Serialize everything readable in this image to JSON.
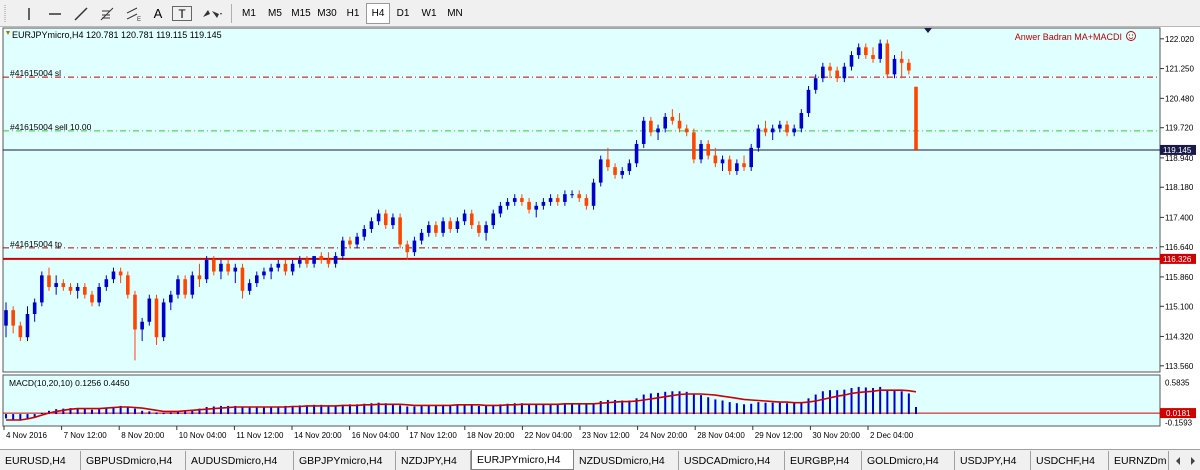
{
  "toolbar": {
    "tools": [
      "vertical-line-icon",
      "horizontal-line-icon",
      "trendline-icon",
      "fibonacci-icon",
      "text-icon",
      "text-label-icon",
      "arrows-icon"
    ],
    "text_tool": "A",
    "label_tool": "T",
    "timeframes": [
      "M1",
      "M5",
      "M15",
      "M30",
      "H1",
      "H4",
      "D1",
      "W1",
      "MN"
    ],
    "active_timeframe": "H4"
  },
  "chart": {
    "header": "EURJPYmicro,H4  120.781 120.781 119.115 119.145",
    "indicator_name": "Anwer Badran MA+MACDI",
    "order_sl_label": "#41615004 sl",
    "order_sell_label": "#41615004 sell 10.00",
    "order_tp_label": "#41615004 tp",
    "bid_price_tag": "119.145",
    "support_price_tag": "116.326",
    "y_axis_ticks": [
      "122.020",
      "121.250",
      "120.480",
      "119.720",
      "118.940",
      "118.180",
      "117.400",
      "116.640",
      "115.860",
      "115.100",
      "114.320",
      "113.560"
    ],
    "y_range": [
      113.4,
      122.3
    ],
    "x_axis_ticks": [
      "4 Nov 2016",
      "7 Nov 12:00",
      "8 Nov 20:00",
      "10 Nov 04:00",
      "11 Nov 12:00",
      "14 Nov 20:00",
      "16 Nov 04:00",
      "17 Nov 12:00",
      "18 Nov 20:00",
      "22 Nov 04:00",
      "23 Nov 12:00",
      "24 Nov 20:00",
      "28 Nov 04:00",
      "29 Nov 12:00",
      "30 Nov 20:00",
      "2 Dec 04:00"
    ],
    "levels": {
      "sl": 121.03,
      "sell": 119.64,
      "bid": 119.145,
      "tp": 116.61,
      "support": 116.326
    },
    "colors": {
      "background": "#e0ffff",
      "bull": "#0000cd",
      "bear": "#ff4500",
      "sl": "#c00000",
      "sell": "#32cd32",
      "support": "#d00000",
      "macd_line": "#d00000"
    }
  },
  "macd": {
    "label": "MACD(10,20,10) 0.1256 0.4450",
    "y_axis_ticks": [
      "0.5835",
      "0.0181",
      "-0.1593"
    ],
    "value_tag": "0.0181",
    "y_range": [
      -0.22,
      0.72
    ]
  },
  "chart_data": {
    "type": "candlestick",
    "title": "EURJPYmicro,H4",
    "candles": [
      {
        "o": 114.6,
        "h": 115.2,
        "l": 114.3,
        "c": 115.0
      },
      {
        "o": 115.0,
        "h": 115.1,
        "l": 114.4,
        "c": 114.6
      },
      {
        "o": 114.6,
        "h": 114.7,
        "l": 114.2,
        "c": 114.3
      },
      {
        "o": 114.3,
        "h": 115.1,
        "l": 114.2,
        "c": 114.9
      },
      {
        "o": 114.9,
        "h": 115.3,
        "l": 114.7,
        "c": 115.2
      },
      {
        "o": 115.2,
        "h": 116.0,
        "l": 115.1,
        "c": 115.9
      },
      {
        "o": 115.9,
        "h": 116.1,
        "l": 115.5,
        "c": 115.6
      },
      {
        "o": 115.6,
        "h": 115.9,
        "l": 115.4,
        "c": 115.7
      },
      {
        "o": 115.7,
        "h": 115.8,
        "l": 115.5,
        "c": 115.6
      },
      {
        "o": 115.6,
        "h": 115.7,
        "l": 115.4,
        "c": 115.5
      },
      {
        "o": 115.5,
        "h": 115.7,
        "l": 115.3,
        "c": 115.6
      },
      {
        "o": 115.6,
        "h": 115.7,
        "l": 115.3,
        "c": 115.4
      },
      {
        "o": 115.4,
        "h": 115.5,
        "l": 115.1,
        "c": 115.2
      },
      {
        "o": 115.2,
        "h": 115.7,
        "l": 115.1,
        "c": 115.6
      },
      {
        "o": 115.6,
        "h": 115.9,
        "l": 115.5,
        "c": 115.8
      },
      {
        "o": 115.8,
        "h": 116.1,
        "l": 115.7,
        "c": 116.0
      },
      {
        "o": 116.0,
        "h": 116.1,
        "l": 115.7,
        "c": 115.9
      },
      {
        "o": 115.9,
        "h": 116.0,
        "l": 115.3,
        "c": 115.4
      },
      {
        "o": 115.4,
        "h": 115.5,
        "l": 113.7,
        "c": 114.5
      },
      {
        "o": 114.5,
        "h": 114.8,
        "l": 114.2,
        "c": 114.7
      },
      {
        "o": 114.7,
        "h": 115.4,
        "l": 114.6,
        "c": 115.3
      },
      {
        "o": 115.3,
        "h": 115.4,
        "l": 114.1,
        "c": 114.3
      },
      {
        "o": 114.3,
        "h": 115.3,
        "l": 114.2,
        "c": 115.2
      },
      {
        "o": 115.2,
        "h": 115.5,
        "l": 115.0,
        "c": 115.4
      },
      {
        "o": 115.4,
        "h": 115.9,
        "l": 115.3,
        "c": 115.8
      },
      {
        "o": 115.8,
        "h": 115.9,
        "l": 115.3,
        "c": 115.4
      },
      {
        "o": 115.4,
        "h": 116.0,
        "l": 115.3,
        "c": 115.9
      },
      {
        "o": 115.9,
        "h": 116.2,
        "l": 115.6,
        "c": 115.8
      },
      {
        "o": 115.8,
        "h": 116.4,
        "l": 115.7,
        "c": 116.3
      },
      {
        "o": 116.3,
        "h": 116.4,
        "l": 115.9,
        "c": 116.0
      },
      {
        "o": 116.0,
        "h": 116.3,
        "l": 115.8,
        "c": 116.2
      },
      {
        "o": 116.2,
        "h": 116.3,
        "l": 115.9,
        "c": 116.0
      },
      {
        "o": 116.0,
        "h": 116.2,
        "l": 115.7,
        "c": 116.1
      },
      {
        "o": 116.1,
        "h": 116.2,
        "l": 115.3,
        "c": 115.5
      },
      {
        "o": 115.5,
        "h": 115.8,
        "l": 115.4,
        "c": 115.7
      },
      {
        "o": 115.7,
        "h": 116.0,
        "l": 115.6,
        "c": 115.9
      },
      {
        "o": 115.9,
        "h": 116.1,
        "l": 115.8,
        "c": 116.0
      },
      {
        "o": 116.0,
        "h": 116.2,
        "l": 115.8,
        "c": 116.1
      },
      {
        "o": 116.1,
        "h": 116.3,
        "l": 116.0,
        "c": 116.2
      },
      {
        "o": 116.2,
        "h": 116.3,
        "l": 115.9,
        "c": 116.0
      },
      {
        "o": 116.0,
        "h": 116.3,
        "l": 115.9,
        "c": 116.2
      },
      {
        "o": 116.2,
        "h": 116.4,
        "l": 116.1,
        "c": 116.3
      },
      {
        "o": 116.3,
        "h": 116.4,
        "l": 116.1,
        "c": 116.2
      },
      {
        "o": 116.2,
        "h": 116.4,
        "l": 116.1,
        "c": 116.4
      },
      {
        "o": 116.4,
        "h": 116.5,
        "l": 116.2,
        "c": 116.3
      },
      {
        "o": 116.3,
        "h": 116.5,
        "l": 116.1,
        "c": 116.2
      },
      {
        "o": 116.2,
        "h": 116.5,
        "l": 116.1,
        "c": 116.4
      },
      {
        "o": 116.4,
        "h": 116.9,
        "l": 116.3,
        "c": 116.8
      },
      {
        "o": 116.8,
        "h": 116.9,
        "l": 116.6,
        "c": 116.7
      },
      {
        "o": 116.7,
        "h": 117.0,
        "l": 116.6,
        "c": 116.9
      },
      {
        "o": 116.9,
        "h": 117.2,
        "l": 116.8,
        "c": 117.1
      },
      {
        "o": 117.1,
        "h": 117.4,
        "l": 117.0,
        "c": 117.3
      },
      {
        "o": 117.3,
        "h": 117.6,
        "l": 117.2,
        "c": 117.5
      },
      {
        "o": 117.5,
        "h": 117.6,
        "l": 117.1,
        "c": 117.2
      },
      {
        "o": 117.2,
        "h": 117.5,
        "l": 117.1,
        "c": 117.4
      },
      {
        "o": 117.4,
        "h": 117.5,
        "l": 116.6,
        "c": 116.7
      },
      {
        "o": 116.7,
        "h": 116.8,
        "l": 116.3,
        "c": 116.5
      },
      {
        "o": 116.5,
        "h": 116.9,
        "l": 116.4,
        "c": 116.8
      },
      {
        "o": 116.8,
        "h": 117.1,
        "l": 116.7,
        "c": 117.0
      },
      {
        "o": 117.0,
        "h": 117.3,
        "l": 116.9,
        "c": 117.2
      },
      {
        "o": 117.2,
        "h": 117.3,
        "l": 116.9,
        "c": 117.0
      },
      {
        "o": 117.0,
        "h": 117.4,
        "l": 116.9,
        "c": 117.3
      },
      {
        "o": 117.3,
        "h": 117.4,
        "l": 117.0,
        "c": 117.1
      },
      {
        "o": 117.1,
        "h": 117.4,
        "l": 117.0,
        "c": 117.3
      },
      {
        "o": 117.3,
        "h": 117.6,
        "l": 117.2,
        "c": 117.5
      },
      {
        "o": 117.5,
        "h": 117.6,
        "l": 117.1,
        "c": 117.2
      },
      {
        "o": 117.2,
        "h": 117.3,
        "l": 116.9,
        "c": 117.0
      },
      {
        "o": 117.0,
        "h": 117.3,
        "l": 116.8,
        "c": 117.2
      },
      {
        "o": 117.2,
        "h": 117.6,
        "l": 117.1,
        "c": 117.5
      },
      {
        "o": 117.5,
        "h": 117.8,
        "l": 117.4,
        "c": 117.7
      },
      {
        "o": 117.7,
        "h": 117.9,
        "l": 117.6,
        "c": 117.8
      },
      {
        "o": 117.8,
        "h": 118.0,
        "l": 117.7,
        "c": 117.9
      },
      {
        "o": 117.9,
        "h": 118.0,
        "l": 117.7,
        "c": 117.8
      },
      {
        "o": 117.8,
        "h": 117.9,
        "l": 117.5,
        "c": 117.6
      },
      {
        "o": 117.6,
        "h": 117.8,
        "l": 117.4,
        "c": 117.7
      },
      {
        "o": 117.7,
        "h": 117.9,
        "l": 117.6,
        "c": 117.8
      },
      {
        "o": 117.8,
        "h": 118.0,
        "l": 117.7,
        "c": 117.9
      },
      {
        "o": 117.9,
        "h": 118.0,
        "l": 117.7,
        "c": 117.8
      },
      {
        "o": 117.8,
        "h": 118.1,
        "l": 117.7,
        "c": 118.0
      },
      {
        "o": 118.0,
        "h": 118.1,
        "l": 117.9,
        "c": 118.0
      },
      {
        "o": 118.0,
        "h": 118.1,
        "l": 117.8,
        "c": 117.9
      },
      {
        "o": 117.9,
        "h": 118.0,
        "l": 117.6,
        "c": 117.7
      },
      {
        "o": 117.7,
        "h": 118.4,
        "l": 117.6,
        "c": 118.3
      },
      {
        "o": 118.3,
        "h": 119.0,
        "l": 118.2,
        "c": 118.9
      },
      {
        "o": 118.9,
        "h": 119.2,
        "l": 118.6,
        "c": 118.7
      },
      {
        "o": 118.7,
        "h": 118.8,
        "l": 118.4,
        "c": 118.5
      },
      {
        "o": 118.5,
        "h": 118.7,
        "l": 118.4,
        "c": 118.6
      },
      {
        "o": 118.6,
        "h": 118.9,
        "l": 118.5,
        "c": 118.8
      },
      {
        "o": 118.8,
        "h": 119.4,
        "l": 118.7,
        "c": 119.3
      },
      {
        "o": 119.3,
        "h": 120.0,
        "l": 119.2,
        "c": 119.9
      },
      {
        "o": 119.9,
        "h": 120.0,
        "l": 119.5,
        "c": 119.6
      },
      {
        "o": 119.6,
        "h": 119.8,
        "l": 119.4,
        "c": 119.7
      },
      {
        "o": 119.7,
        "h": 120.1,
        "l": 119.6,
        "c": 120.0
      },
      {
        "o": 120.0,
        "h": 120.2,
        "l": 119.8,
        "c": 119.9
      },
      {
        "o": 119.9,
        "h": 120.1,
        "l": 119.6,
        "c": 119.7
      },
      {
        "o": 119.7,
        "h": 119.8,
        "l": 119.5,
        "c": 119.6
      },
      {
        "o": 119.6,
        "h": 119.7,
        "l": 118.8,
        "c": 118.9
      },
      {
        "o": 118.9,
        "h": 119.4,
        "l": 118.8,
        "c": 119.3
      },
      {
        "o": 119.3,
        "h": 119.4,
        "l": 118.9,
        "c": 119.0
      },
      {
        "o": 119.0,
        "h": 119.2,
        "l": 118.7,
        "c": 118.8
      },
      {
        "o": 118.8,
        "h": 119.0,
        "l": 118.6,
        "c": 118.9
      },
      {
        "o": 118.9,
        "h": 119.0,
        "l": 118.5,
        "c": 118.6
      },
      {
        "o": 118.6,
        "h": 118.9,
        "l": 118.5,
        "c": 118.8
      },
      {
        "o": 118.8,
        "h": 119.0,
        "l": 118.6,
        "c": 118.7
      },
      {
        "o": 118.7,
        "h": 119.3,
        "l": 118.6,
        "c": 119.2
      },
      {
        "o": 119.2,
        "h": 119.8,
        "l": 119.1,
        "c": 119.7
      },
      {
        "o": 119.7,
        "h": 119.9,
        "l": 119.5,
        "c": 119.6
      },
      {
        "o": 119.6,
        "h": 119.8,
        "l": 119.4,
        "c": 119.7
      },
      {
        "o": 119.7,
        "h": 119.9,
        "l": 119.6,
        "c": 119.8
      },
      {
        "o": 119.8,
        "h": 119.9,
        "l": 119.5,
        "c": 119.6
      },
      {
        "o": 119.6,
        "h": 119.8,
        "l": 119.5,
        "c": 119.7
      },
      {
        "o": 119.7,
        "h": 120.2,
        "l": 119.6,
        "c": 120.1
      },
      {
        "o": 120.1,
        "h": 120.8,
        "l": 120.0,
        "c": 120.7
      },
      {
        "o": 120.7,
        "h": 121.1,
        "l": 120.6,
        "c": 121.0
      },
      {
        "o": 121.0,
        "h": 121.4,
        "l": 120.9,
        "c": 121.3
      },
      {
        "o": 121.3,
        "h": 121.4,
        "l": 121.0,
        "c": 121.2
      },
      {
        "o": 121.2,
        "h": 121.3,
        "l": 120.9,
        "c": 121.0
      },
      {
        "o": 121.0,
        "h": 121.4,
        "l": 120.9,
        "c": 121.3
      },
      {
        "o": 121.3,
        "h": 121.7,
        "l": 121.2,
        "c": 121.6
      },
      {
        "o": 121.6,
        "h": 121.9,
        "l": 121.5,
        "c": 121.8
      },
      {
        "o": 121.8,
        "h": 121.9,
        "l": 121.5,
        "c": 121.6
      },
      {
        "o": 121.6,
        "h": 121.8,
        "l": 121.4,
        "c": 121.5
      },
      {
        "o": 121.5,
        "h": 122.0,
        "l": 121.4,
        "c": 121.9
      },
      {
        "o": 121.9,
        "h": 122.0,
        "l": 121.0,
        "c": 121.1
      },
      {
        "o": 121.1,
        "h": 121.6,
        "l": 121.0,
        "c": 121.5
      },
      {
        "o": 121.5,
        "h": 121.7,
        "l": 121.0,
        "c": 121.4
      },
      {
        "o": 121.4,
        "h": 121.5,
        "l": 121.1,
        "c": 121.2
      },
      {
        "o": 120.78,
        "h": 120.78,
        "l": 119.12,
        "c": 119.15
      }
    ],
    "macd_histogram": [
      -0.08,
      -0.1,
      -0.12,
      -0.1,
      -0.05,
      0.02,
      0.06,
      0.09,
      0.1,
      0.11,
      0.11,
      0.1,
      0.08,
      0.09,
      0.11,
      0.13,
      0.15,
      0.14,
      0.1,
      0.06,
      0.05,
      0.03,
      0.02,
      0.03,
      0.05,
      0.07,
      0.08,
      0.1,
      0.13,
      0.14,
      0.15,
      0.15,
      0.15,
      0.13,
      0.12,
      0.12,
      0.12,
      0.13,
      0.14,
      0.15,
      0.15,
      0.16,
      0.16,
      0.17,
      0.17,
      0.16,
      0.16,
      0.17,
      0.18,
      0.18,
      0.19,
      0.2,
      0.21,
      0.2,
      0.19,
      0.16,
      0.14,
      0.14,
      0.15,
      0.16,
      0.16,
      0.17,
      0.17,
      0.17,
      0.18,
      0.17,
      0.15,
      0.15,
      0.16,
      0.18,
      0.19,
      0.2,
      0.2,
      0.19,
      0.18,
      0.18,
      0.19,
      0.19,
      0.2,
      0.2,
      0.2,
      0.19,
      0.2,
      0.24,
      0.26,
      0.26,
      0.25,
      0.25,
      0.29,
      0.36,
      0.38,
      0.39,
      0.41,
      0.42,
      0.42,
      0.41,
      0.36,
      0.35,
      0.31,
      0.27,
      0.25,
      0.22,
      0.2,
      0.18,
      0.19,
      0.22,
      0.21,
      0.21,
      0.21,
      0.2,
      0.2,
      0.22,
      0.29,
      0.36,
      0.42,
      0.44,
      0.44,
      0.45,
      0.48,
      0.5,
      0.49,
      0.48,
      0.5,
      0.45,
      0.44,
      0.42,
      0.38,
      0.13
    ],
    "macd_signal": [
      -0.11,
      -0.11,
      -0.11,
      -0.09,
      -0.06,
      -0.02,
      0.02,
      0.05,
      0.07,
      0.09,
      0.1,
      0.1,
      0.1,
      0.1,
      0.11,
      0.12,
      0.13,
      0.13,
      0.12,
      0.11,
      0.09,
      0.07,
      0.05,
      0.05,
      0.05,
      0.06,
      0.07,
      0.08,
      0.09,
      0.1,
      0.11,
      0.12,
      0.13,
      0.13,
      0.13,
      0.13,
      0.13,
      0.13,
      0.13,
      0.13,
      0.14,
      0.14,
      0.15,
      0.15,
      0.15,
      0.15,
      0.15,
      0.16,
      0.16,
      0.16,
      0.17,
      0.17,
      0.18,
      0.18,
      0.18,
      0.18,
      0.17,
      0.16,
      0.16,
      0.16,
      0.16,
      0.16,
      0.16,
      0.17,
      0.17,
      0.17,
      0.17,
      0.16,
      0.16,
      0.16,
      0.17,
      0.17,
      0.18,
      0.18,
      0.18,
      0.18,
      0.18,
      0.18,
      0.19,
      0.19,
      0.19,
      0.19,
      0.19,
      0.2,
      0.21,
      0.22,
      0.23,
      0.23,
      0.24,
      0.26,
      0.28,
      0.3,
      0.32,
      0.34,
      0.36,
      0.37,
      0.37,
      0.37,
      0.36,
      0.35,
      0.33,
      0.31,
      0.29,
      0.27,
      0.26,
      0.25,
      0.24,
      0.23,
      0.22,
      0.22,
      0.21,
      0.21,
      0.22,
      0.24,
      0.27,
      0.3,
      0.33,
      0.35,
      0.38,
      0.4,
      0.41,
      0.42,
      0.44,
      0.44,
      0.44,
      0.44,
      0.43,
      0.41
    ]
  }
}
